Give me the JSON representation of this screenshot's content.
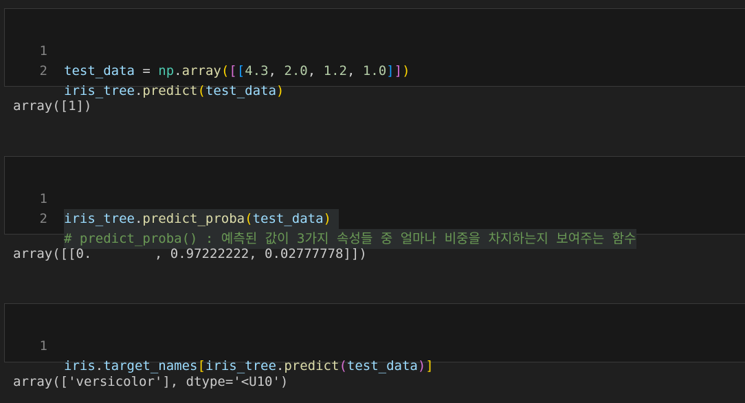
{
  "cells": [
    {
      "lines": [
        {
          "number": "1",
          "tokens": {
            "t1": "test_data",
            "t2": " = ",
            "t3": "np",
            "t4": ".",
            "t5": "array",
            "t6": "(",
            "t7": "[",
            "t8": "[",
            "t9": "4.3",
            "t10": ", ",
            "t11": "2.0",
            "t12": ", ",
            "t13": "1.2",
            "t14": ", ",
            "t15": "1.0",
            "t16": "]",
            "t17": "]",
            "t18": ")"
          }
        },
        {
          "number": "2",
          "tokens": {
            "t1": "iris_tree",
            "t2": ".",
            "t3": "predict",
            "t4": "(",
            "t5": "test_data",
            "t6": ")"
          }
        }
      ],
      "output": "array([1])"
    },
    {
      "lines": [
        {
          "number": "1",
          "tokens": {
            "t1": "iris_tree",
            "t2": ".",
            "t3": "predict_proba",
            "t4": "(",
            "t5": "test_data",
            "t6": ")"
          }
        },
        {
          "number": "2",
          "tokens": {
            "t1": "# predict_proba() : 예측된 값이 3가지 속성들 중 얼마나 비중을 차지하는지 보여주는 함수"
          }
        }
      ],
      "output": "array([[0.        , 0.97222222, 0.02777778]])"
    },
    {
      "lines": [
        {
          "number": "1",
          "tokens": {
            "t1": "iris",
            "t2": ".",
            "t3": "target_names",
            "t4": "[",
            "t5": "iris_tree",
            "t6": ".",
            "t7": "predict",
            "t8": "(",
            "t9": "test_data",
            "t10": ")",
            "t11": "]"
          }
        }
      ],
      "output": "array(['versicolor'], dtype='<U10')"
    }
  ],
  "theme": {
    "background": "#1f1f1f",
    "cell_background": "#181818",
    "cell_border": "#3a3a3a",
    "variable": "#9cdcfe",
    "function": "#dcdcaa",
    "module": "#4ec9b0",
    "number": "#b5cea8",
    "bracket_1": "#ffd700",
    "bracket_2": "#da70d6",
    "bracket_3": "#179fff",
    "comment": "#6a9955",
    "line_number": "#858585",
    "output_text": "#cccccc"
  }
}
